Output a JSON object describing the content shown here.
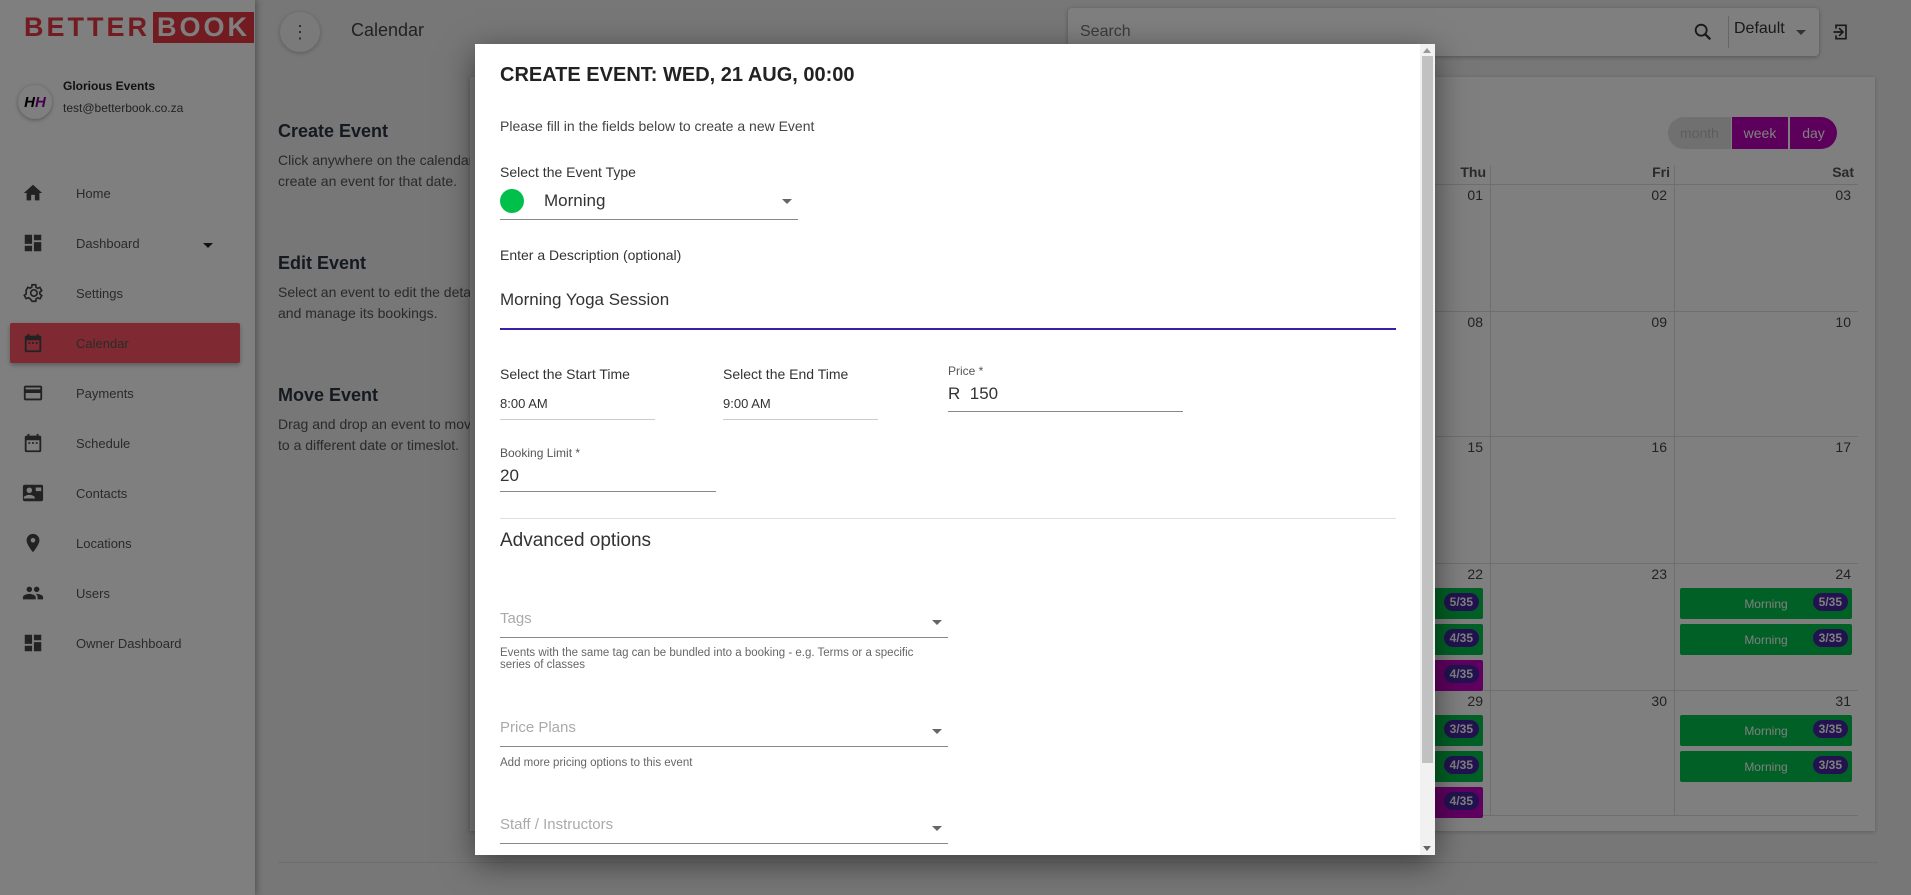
{
  "brand": {
    "part1": "BETTER",
    "part2": "BOOK",
    "color": "#e53945"
  },
  "account": {
    "avatar_text": "HH",
    "name": "Glorious Events",
    "email": "test@betterbook.co.za"
  },
  "sidebar": {
    "items": [
      {
        "label": "Home",
        "icon": "home-icon"
      },
      {
        "label": "Dashboard",
        "icon": "dashboard-icon",
        "has_dropdown": true
      },
      {
        "label": "Settings",
        "icon": "gear-icon"
      },
      {
        "label": "Calendar",
        "icon": "calendar-icon",
        "active": true
      },
      {
        "label": "Payments",
        "icon": "credit-card-icon"
      },
      {
        "label": "Schedule",
        "icon": "calendar-icon"
      },
      {
        "label": "Contacts",
        "icon": "contact-card-icon"
      },
      {
        "label": "Locations",
        "icon": "location-pin-icon"
      },
      {
        "label": "Users",
        "icon": "users-icon"
      },
      {
        "label": "Owner Dashboard",
        "icon": "dashboard-icon"
      }
    ]
  },
  "header": {
    "title": "Calendar",
    "search_placeholder": "Search",
    "view_select": "Default"
  },
  "help": [
    {
      "title": "Create Event",
      "line1": "Click anywhere on the calendar t",
      "line2": "create an event for that date."
    },
    {
      "title": "Edit Event",
      "line1": "Select an event to edit the details",
      "line2": "and manage its bookings."
    },
    {
      "title": "Move Event",
      "line1": "Drag and drop an event to move",
      "line2": "to a different date or timeslot."
    }
  ],
  "calendar": {
    "views": [
      "month",
      "week",
      "day"
    ],
    "active_view": "month",
    "headers": [
      "Thu",
      "Fri",
      "Sat"
    ],
    "weeks": [
      [
        "01",
        "02",
        "03"
      ],
      [
        "08",
        "09",
        "10"
      ],
      [
        "15",
        "16",
        "17"
      ],
      [
        "22",
        "23",
        "24"
      ],
      [
        "29",
        "30",
        "31"
      ]
    ],
    "events": [
      {
        "week": 3,
        "day": 0,
        "items": [
          {
            "label": "",
            "count": "5/35",
            "color": "#00c04b"
          },
          {
            "label": "",
            "count": "4/35",
            "color": "#00c04b"
          },
          {
            "label": "",
            "count": "4/35",
            "color": "#c000c0"
          }
        ]
      },
      {
        "week": 3,
        "day": 2,
        "items": [
          {
            "label": "Morning",
            "count": "5/35",
            "color": "#00c04b"
          },
          {
            "label": "Morning",
            "count": "3/35",
            "color": "#00c04b"
          }
        ]
      },
      {
        "week": 4,
        "day": 0,
        "items": [
          {
            "label": "",
            "count": "3/35",
            "color": "#00c04b"
          },
          {
            "label": "",
            "count": "4/35",
            "color": "#00c04b"
          },
          {
            "label": "",
            "count": "4/35",
            "color": "#c000c0"
          }
        ]
      },
      {
        "week": 4,
        "day": 2,
        "items": [
          {
            "label": "Morning",
            "count": "3/35",
            "color": "#00c04b"
          },
          {
            "label": "Morning",
            "count": "3/35",
            "color": "#00c04b"
          }
        ]
      }
    ]
  },
  "modal": {
    "title": "CREATE EVENT: WED, 21 AUG, 00:00",
    "subtitle": "Please fill in the fields below to create a new Event",
    "event_type_label": "Select the Event Type",
    "event_type_value": "Morning",
    "event_type_color": "#00c04b",
    "description_label": "Enter a Description (optional)",
    "description_value": "Morning Yoga Session",
    "start_label": "Select the Start Time",
    "start_value": "8:00 AM",
    "end_label": "Select the End Time",
    "end_value": "9:00 AM",
    "price_label": "Price *",
    "price_prefix": "R",
    "price_value": "150",
    "limit_label": "Booking Limit *",
    "limit_value": "20",
    "advanced_label": "Advanced options",
    "tags_placeholder": "Tags",
    "tags_helper": "Events with the same tag can be bundled into a booking - e.g. Terms or a specific series of classes",
    "plans_placeholder": "Price Plans",
    "plans_helper": "Add more pricing options to this event",
    "staff_placeholder": "Staff / Instructors",
    "accent_color": "#3a1fa8"
  }
}
